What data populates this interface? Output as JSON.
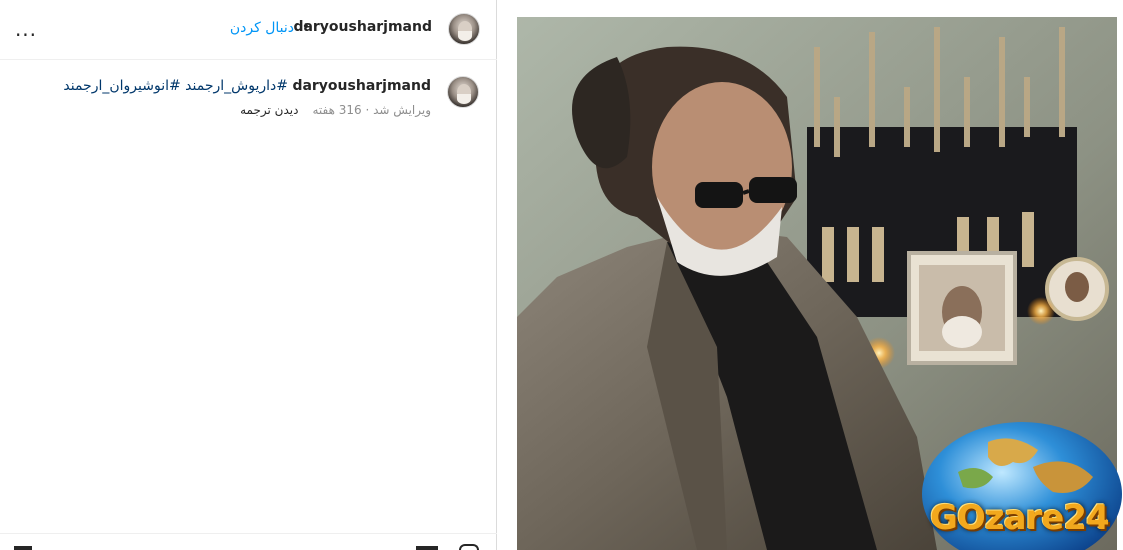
{
  "header": {
    "username": "daryousharjmand",
    "separator": "•",
    "follow_label": "دنبال کردن",
    "more_label": "..."
  },
  "caption": {
    "username": "daryousharjmand",
    "hashtags": "#داریوش_ارجمند #انوشیروان_ارجمند",
    "edited_time": "ویرایش شد · 316 هفته",
    "see_translation": "دیدن ترجمه"
  },
  "post_image": {
    "description_icon": "photo-of-bearded-man-in-glasses-and-tweed-jacket",
    "watermark": "GOzare24"
  },
  "colors": {
    "link_blue": "#0095f6",
    "hashtag_blue": "#00376b",
    "muted_gray": "#8e8e8e",
    "watermark_orange": "#f2a81d"
  }
}
